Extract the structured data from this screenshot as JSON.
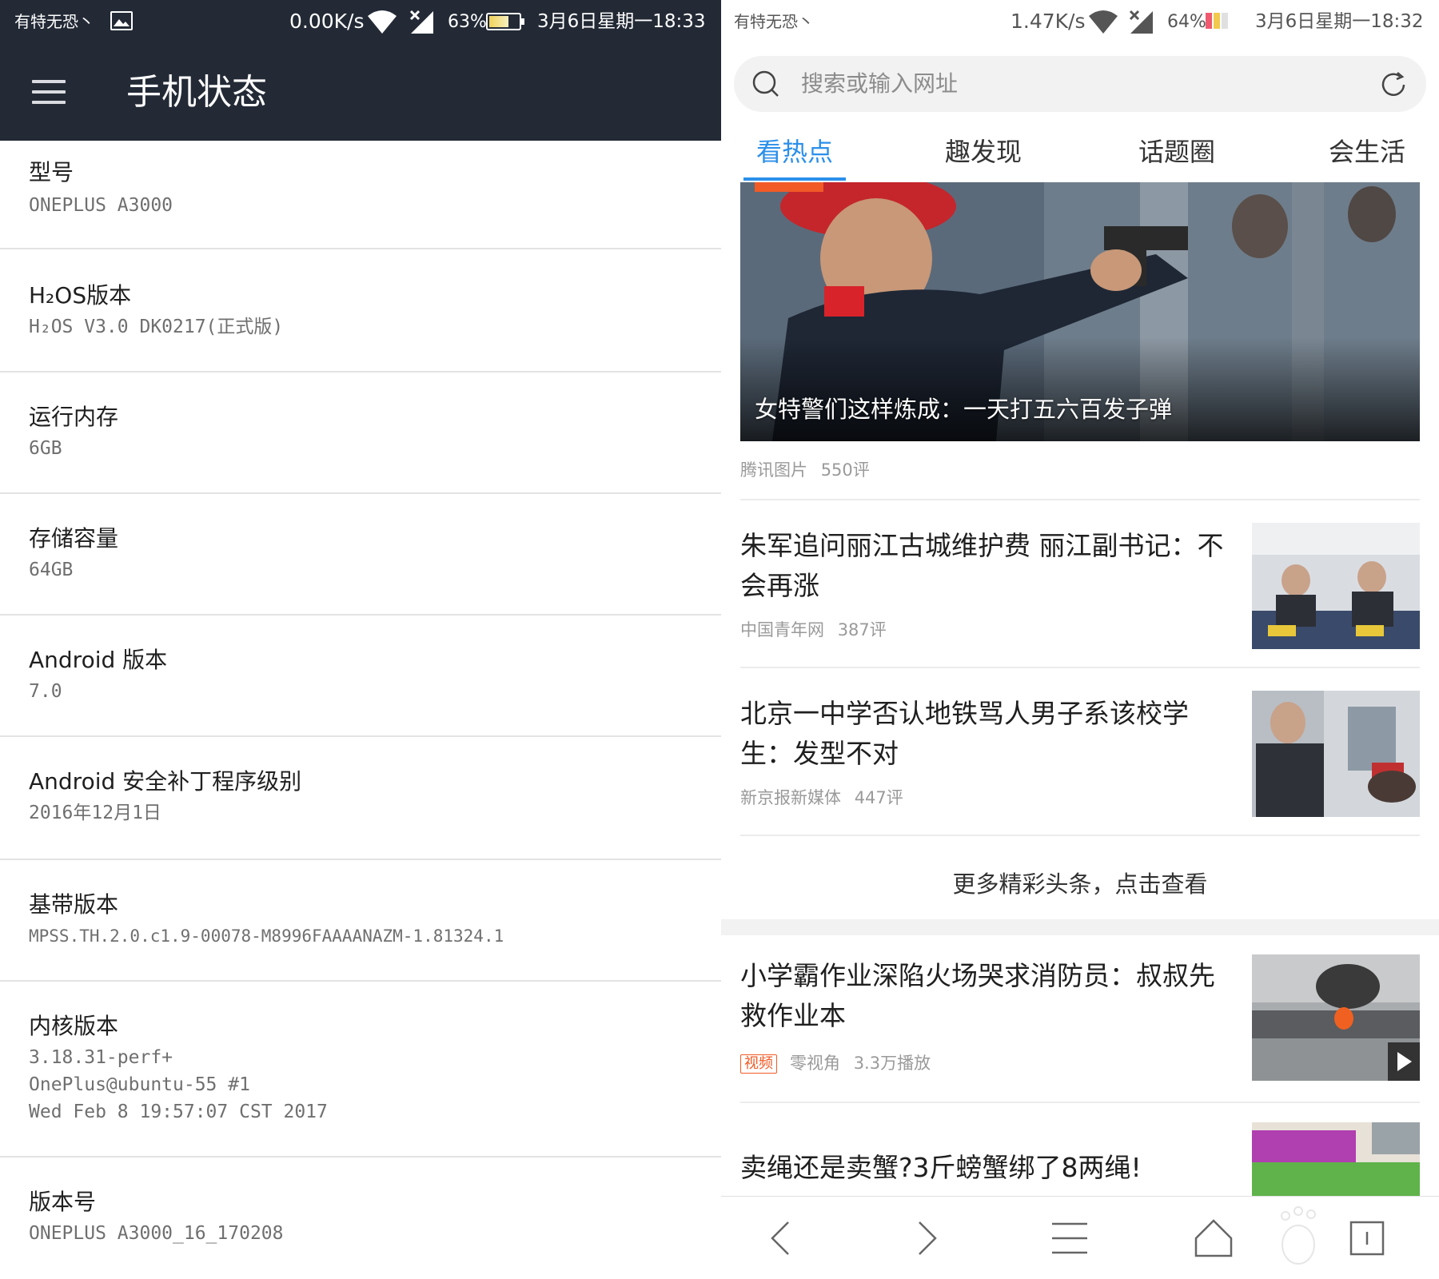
{
  "left": {
    "statusbar": {
      "carrier": "有特无恐丶",
      "speed": "0.00K/s",
      "battery": "63%",
      "datetime": "3月6日星期一18:33"
    },
    "appbar": {
      "title": "手机状态"
    },
    "items": [
      {
        "label": "型号",
        "value": "ONEPLUS A3000"
      },
      {
        "label": "H₂OS版本",
        "value": "H₂OS V3.0 DK0217(正式版)"
      },
      {
        "label": "运行内存",
        "value": "6GB"
      },
      {
        "label": "存储容量",
        "value": "64GB"
      },
      {
        "label": "Android 版本",
        "value": "7.0"
      },
      {
        "label": "Android 安全补丁程序级别",
        "value": "2016年12月1日"
      },
      {
        "label": "基带版本",
        "value": "MPSS.TH.2.0.c1.9-00078-M8996FAAAANAZM-1.81324.1"
      },
      {
        "label": "内核版本",
        "value_lines": [
          "3.18.31-perf+",
          "OnePlus@ubuntu-55 #1",
          "Wed Feb 8 19:57:07 CST 2017"
        ]
      },
      {
        "label": "版本号",
        "value": "ONEPLUS A3000_16_170208"
      }
    ]
  },
  "right": {
    "statusbar": {
      "carrier": "有特无恐丶",
      "speed": "1.47K/s",
      "battery": "64%",
      "datetime": "3月6日星期一18:32"
    },
    "search": {
      "placeholder": "搜索或输入网址"
    },
    "tabs": [
      "看热点",
      "趣发现",
      "话题圈",
      "会生活"
    ],
    "active_tab": 0,
    "hero": {
      "caption": "女特警们这样炼成：一天打五六百发子弹",
      "source": "腾讯图片",
      "comments": "550评"
    },
    "news": [
      {
        "title": "朱军追问丽江古城维护费 丽江副书记：不会再涨",
        "source": "中国青年网",
        "comments": "387评"
      },
      {
        "title": "北京一中学否认地铁骂人男子系该校学生：发型不对",
        "source": "新京报新媒体",
        "comments": "447评"
      }
    ],
    "more_link": "更多精彩头条，点击查看",
    "news2": [
      {
        "title": "小学霸作业深陷火场哭求消防员：叔叔先救作业本",
        "badge": "视频",
        "source": "零视角",
        "plays": "3.3万播放"
      },
      {
        "title": "卖绳还是卖蟹?3斤螃蟹绑了8两绳!"
      }
    ],
    "colors": {
      "accent": "#2b8fea",
      "tag": "#f25a26"
    }
  }
}
